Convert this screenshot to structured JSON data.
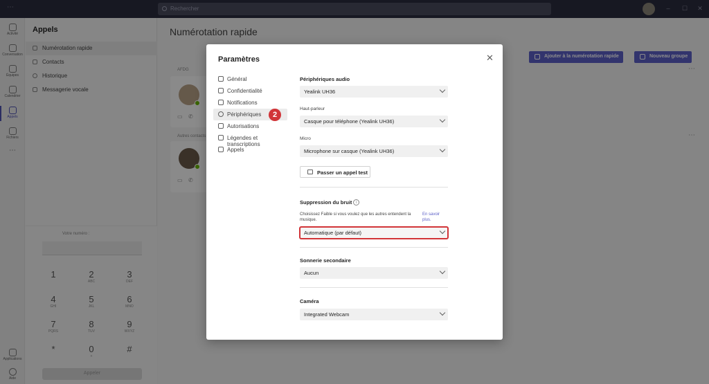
{
  "topbar": {
    "search_placeholder": "Rechercher"
  },
  "rail": {
    "items": [
      {
        "label": "Activité"
      },
      {
        "label": "Conversation"
      },
      {
        "label": "Équipes"
      },
      {
        "label": "Calendrier"
      },
      {
        "label": "Appels"
      },
      {
        "label": "Fichiers"
      },
      {
        "label": "Applications"
      },
      {
        "label": "Aide"
      }
    ]
  },
  "calls": {
    "title": "Appels",
    "nav": [
      {
        "label": "Numérotation rapide"
      },
      {
        "label": "Contacts"
      },
      {
        "label": "Historique"
      },
      {
        "label": "Messagerie vocale"
      }
    ],
    "my_number_label": "Votre numéro :",
    "call_button": "Appeler",
    "keys": [
      {
        "d": "1",
        "l": ""
      },
      {
        "d": "2",
        "l": "ABC"
      },
      {
        "d": "3",
        "l": "DEF"
      },
      {
        "d": "4",
        "l": "GHI"
      },
      {
        "d": "5",
        "l": "JKL"
      },
      {
        "d": "6",
        "l": "MNO"
      },
      {
        "d": "7",
        "l": "PQRS"
      },
      {
        "d": "8",
        "l": "TUV"
      },
      {
        "d": "9",
        "l": "WXYZ"
      },
      {
        "d": "*",
        "l": ""
      },
      {
        "d": "0",
        "l": "+"
      },
      {
        "d": "#",
        "l": ""
      }
    ]
  },
  "main": {
    "title": "Numérotation rapide",
    "add_button": "Ajouter à la numérotation rapide",
    "new_group_button": "Nouveau groupe",
    "section1": "AFDG",
    "section2": "Autres contacts"
  },
  "modal": {
    "title": "Paramètres",
    "close_glyph": "✕",
    "nav": [
      {
        "label": "Général"
      },
      {
        "label": "Confidentialité"
      },
      {
        "label": "Notifications"
      },
      {
        "label": "Périphériques"
      },
      {
        "label": "Autorisations"
      },
      {
        "label": "Légendes et transcriptions"
      },
      {
        "label": "Appels"
      }
    ],
    "step_badge": "2",
    "audio_title": "Périphériques audio",
    "audio_device": "Yealink UH36",
    "speaker_label": "Haut-parleur",
    "speaker_value": "Casque pour téléphone (Yealink UH36)",
    "mic_label": "Micro",
    "mic_value": "Microphone sur casque (Yealink UH36)",
    "test_call": "Passer un appel test",
    "noise_title": "Suppression du bruit",
    "noise_desc": "Choisissez Faible si vous voulez que les autres entendent la musique.",
    "learn_more": "En savoir plus.",
    "noise_value": "Automatique (par défaut)",
    "ring_title": "Sonnerie secondaire",
    "ring_value": "Aucun",
    "camera_title": "Caméra",
    "camera_value": "Integrated Webcam"
  },
  "colors": {
    "accent": "#5b5fc7",
    "highlight": "#d13438",
    "titlebar": "#2b2c3e"
  }
}
